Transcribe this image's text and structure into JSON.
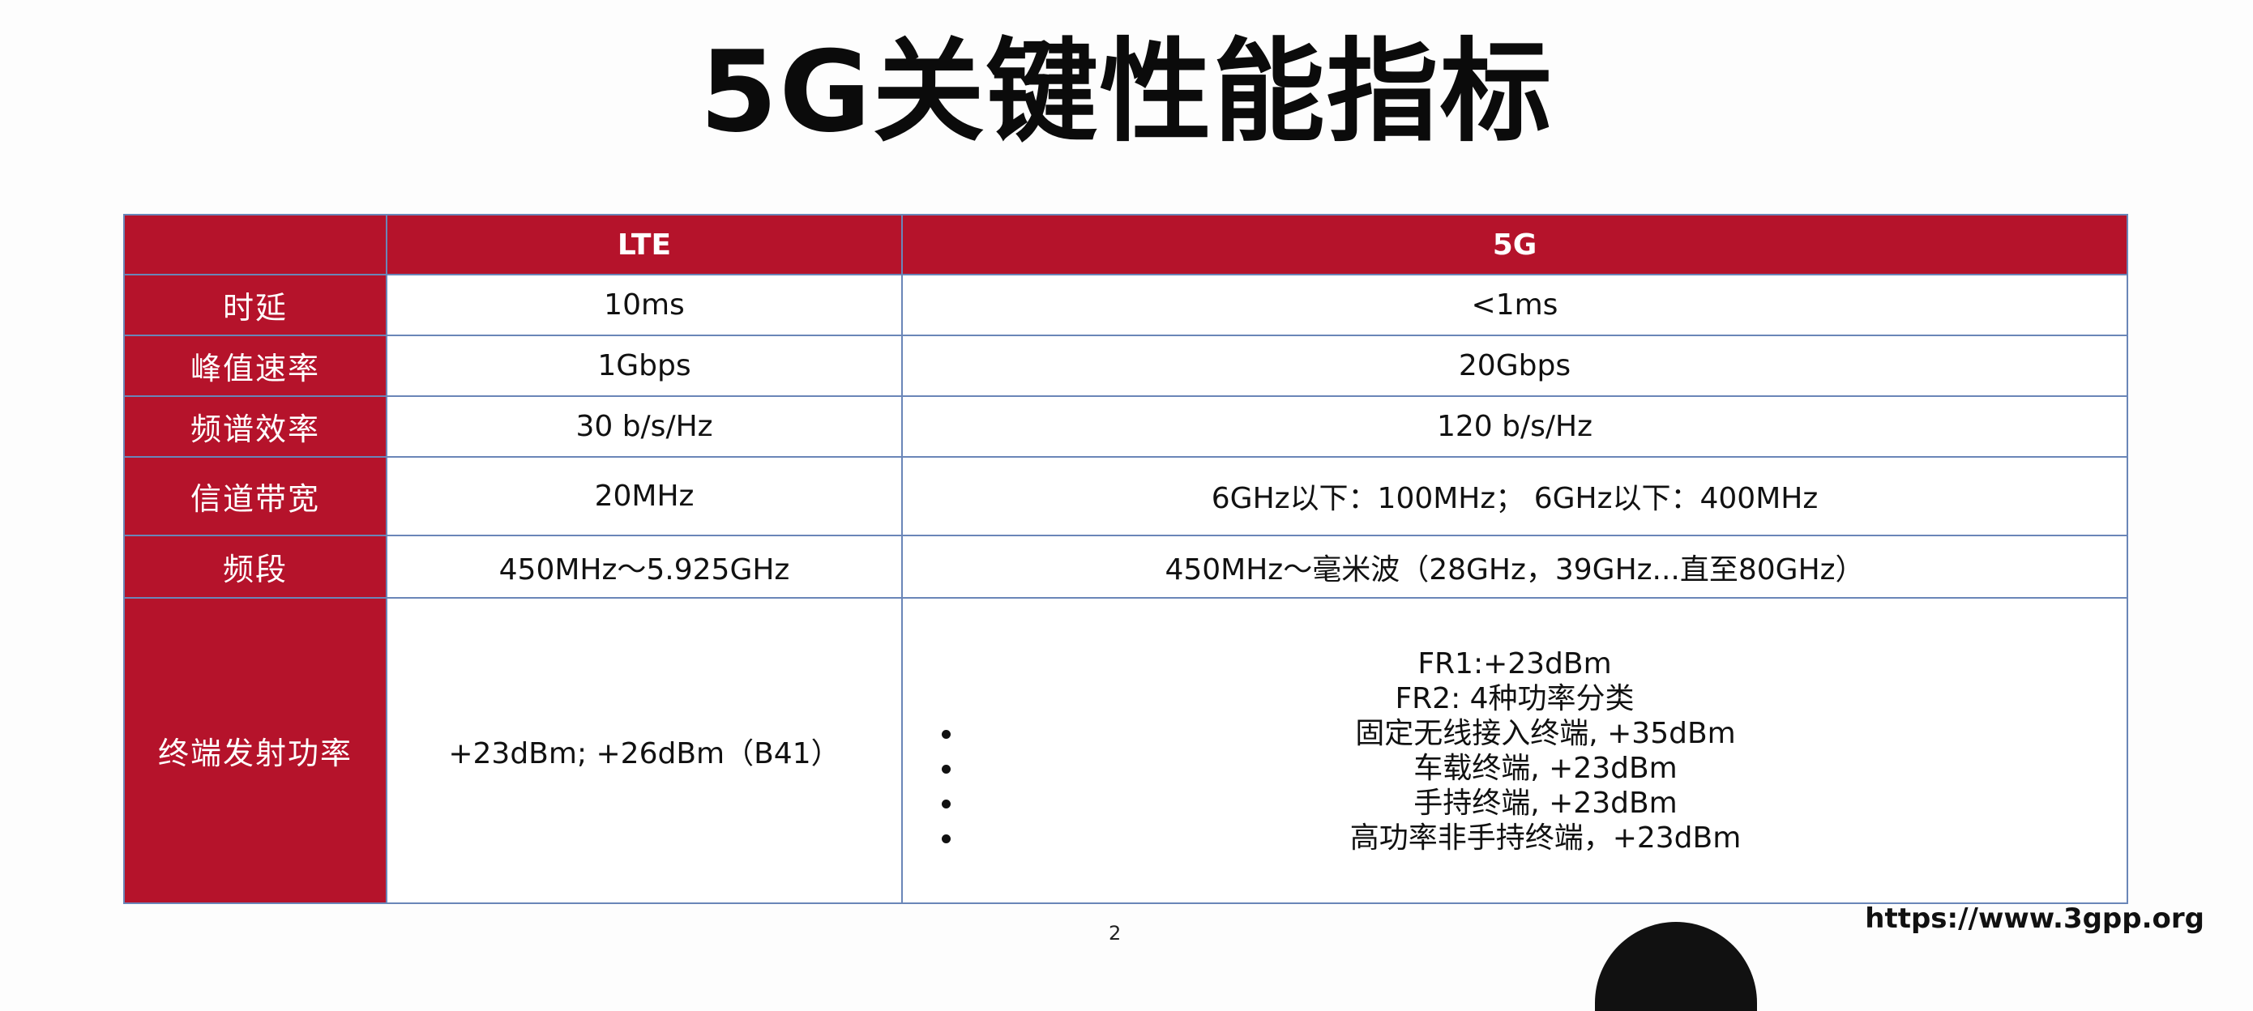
{
  "title": "5G关键性能指标",
  "table": {
    "header": [
      "",
      "LTE",
      "5G"
    ],
    "rows": [
      {
        "label": "时延",
        "lte": "10ms",
        "g5": "<1ms"
      },
      {
        "label": "峰值速率",
        "lte": "1Gbps",
        "g5": "20Gbps"
      },
      {
        "label": "频谱效率",
        "lte": "30 b/s/Hz",
        "g5": "120 b/s/Hz"
      },
      {
        "label": "信道带宽",
        "lte": "20MHz",
        "g5": "6GHz以下：100MHz； 6GHz以下：400MHz"
      },
      {
        "label": "频段",
        "lte": "450MHz～5.925GHz",
        "g5": "450MHz～毫米波（28GHz，39GHz...直至80GHz）"
      },
      {
        "label": "终端发射功率",
        "lte": "+23dBm; +26dBm（B41）",
        "g5_lines": [
          "FR1:+23dBm",
          "FR2: 4种功率分类"
        ],
        "g5_bullets": [
          "固定无线接入终端, +35dBm",
          "车载终端, +23dBm",
          "手持终端, +23dBm",
          "高功率非手持终端，+23dBm"
        ]
      }
    ]
  },
  "page_number": "2",
  "source": "https://www.3gpp.org",
  "colors": {
    "header_red": "#b5132b",
    "grid_blue": "#6a86b8"
  }
}
